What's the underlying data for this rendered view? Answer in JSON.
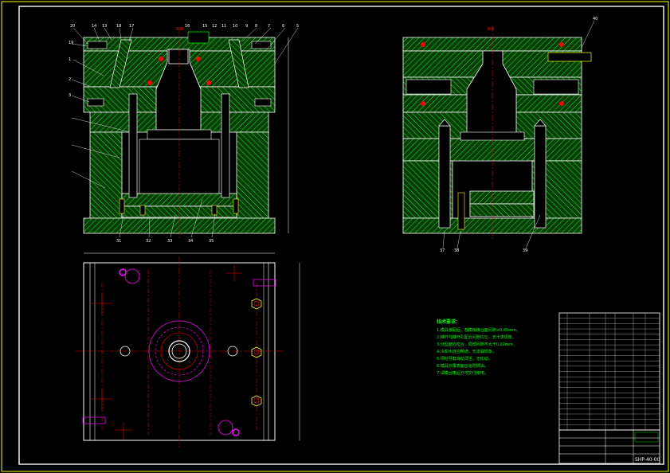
{
  "drawing": {
    "section_label": "B-B",
    "technical_requirements": {
      "title": "技术要求：",
      "lines": [
        "1.模具装配后，各模板接合面间隙≤0.05mm。",
        "2.推杆与推杆孔配合间隙均匀，无卡滞现象。",
        "3.分型面应密合，局部间隙不大于0.02mm。",
        "4.冷却水道应畅通，无渗漏现象。",
        "5.导柱导套滑动灵活，无松动。",
        "6.模具外露表面应涂防锈油。",
        "7.试模合格后方可交付使用。"
      ]
    },
    "title_block": {
      "drawing_number": "SHP-40-00"
    },
    "part_callouts_top": [
      "20",
      "14",
      "13",
      "18",
      "17",
      "16",
      "15",
      "12",
      "11",
      "10",
      "9",
      "8",
      "7",
      "6",
      "5",
      "4"
    ],
    "part_callouts_left": [
      "19",
      "1",
      "2",
      "3"
    ],
    "part_callouts_right": [
      "40"
    ],
    "part_callouts_bottom": [
      "31",
      "32",
      "33",
      "34",
      "35"
    ],
    "part_callouts_side_bottom": [
      "37",
      "38",
      "39"
    ]
  },
  "colors": {
    "background": "#000000",
    "border": "#ffffff",
    "frame": "#ffff00",
    "hatch": "#00ff00",
    "centerline": "#ff0000",
    "circles": "#ff00ff"
  }
}
